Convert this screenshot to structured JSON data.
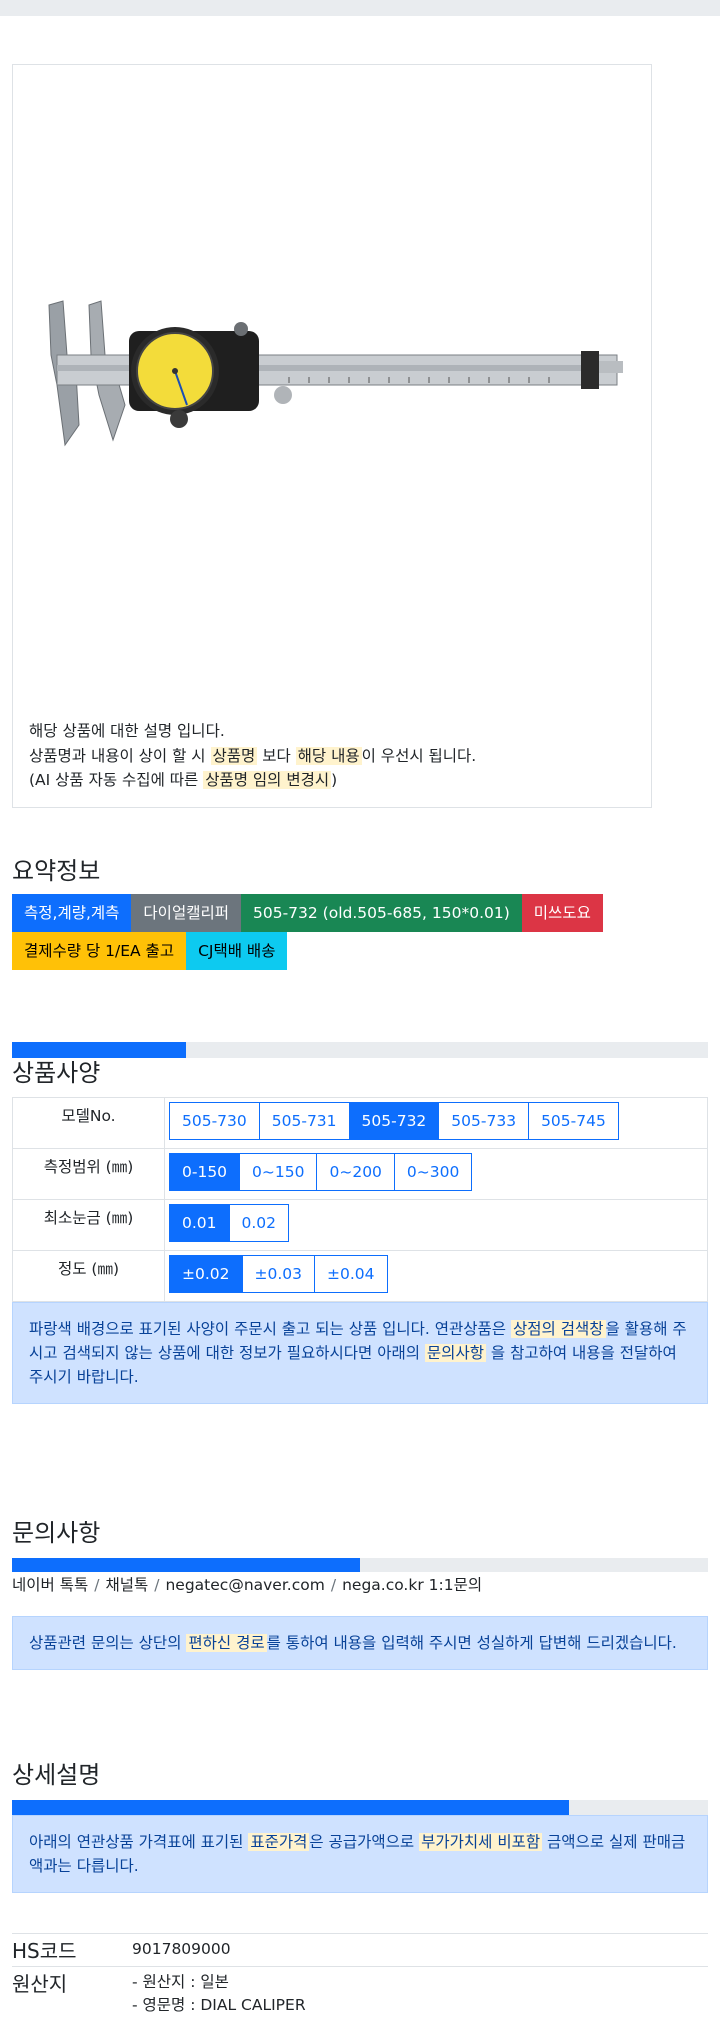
{
  "image_note": {
    "line1": "해당 상품에 대한 설명 입니다.",
    "line2_a": "상품명과 내용이 상이 할 시 ",
    "line2_hl1": "상품명",
    "line2_b": " 보다 ",
    "line2_hl2": "해당 내용",
    "line2_c": "이 우선시 됩니다.",
    "line3_a": "(AI 상품 자동 수집에 따른 ",
    "line3_hl": "상품명 임의 변경시",
    "line3_b": ")"
  },
  "summary": {
    "title": "요약정보",
    "badges": [
      {
        "label": "측정,계량,계측",
        "color": "#0d6efd"
      },
      {
        "label": "다이얼캘리퍼",
        "color": "#6c757d"
      },
      {
        "label": "505-732 (old.505-685, 150*0.01)",
        "color": "#198754"
      },
      {
        "label": "미쓰도요",
        "color": "#dc3545"
      },
      {
        "label": "결제수량 당 1/EA 출고",
        "color": "#ffc107"
      },
      {
        "label": "CJ택배 배송",
        "color": "#0dcaf0"
      }
    ]
  },
  "specs": {
    "title": "상품사양",
    "progress": 0.25,
    "rows": [
      {
        "label": "모델No.",
        "options": [
          "505-730",
          "505-731",
          "505-732",
          "505-733",
          "505-745"
        ],
        "selected": "505-732"
      },
      {
        "label": "측정범위 (㎜)",
        "options": [
          "0-150",
          "0~150",
          "0~200",
          "0~300"
        ],
        "selected": "0-150"
      },
      {
        "label": "최소눈금 (㎜)",
        "options": [
          "0.01",
          "0.02"
        ],
        "selected": "0.01"
      },
      {
        "label": "정도 (㎜)",
        "options": [
          "±0.02",
          "±0.03",
          "±0.04"
        ],
        "selected": "±0.02"
      }
    ],
    "notice": {
      "a": "파랑색 배경으로 표기된 사양이 주문시 출고 되는 상품 입니다. 연관상품은 ",
      "hl1": "상점의 검색창",
      "b": "을 활용해 주시고 검색되지 않는 상품에 대한 정보가 필요하시다면 아래의 ",
      "hl2": "문의사항",
      "c": " 을 참고하여 내용을 전달하여 주시기 바랍니다."
    }
  },
  "inquiry": {
    "title": "문의사항",
    "progress": 0.5,
    "links": [
      "네이버 톡톡",
      "채널톡",
      "negatec@naver.com",
      "nega.co.kr 1:1문의"
    ],
    "separator": "/",
    "notice": {
      "a": "상품관련 문의는 상단의 ",
      "hl": "편하신 경로",
      "b": "를 통하여 내용을 입력해 주시면 성실하게 답변해 드리겠습니다."
    }
  },
  "detail": {
    "title": "상세설명",
    "progress": 0.8,
    "notice": {
      "a": "아래의 연관상품 가격표에 표기된 ",
      "hl1": "표준가격",
      "b": "은 공급가액으로 ",
      "hl2": "부가가치세 비포함",
      "c": " 금액으로 실제 판매금액과는 다릅니다."
    }
  },
  "info": {
    "hs_label": "HS코드",
    "hs_value": "9017809000",
    "origin_label": "원산지",
    "origin_line1": "- 원산지 : 일본",
    "origin_line2": "- 영문명 : DIAL CALIPER"
  },
  "colors": {
    "primary": "#0d6efd",
    "highlight": "#fff3cd",
    "alert_bg": "#cfe2ff",
    "alert_text": "#084298"
  }
}
